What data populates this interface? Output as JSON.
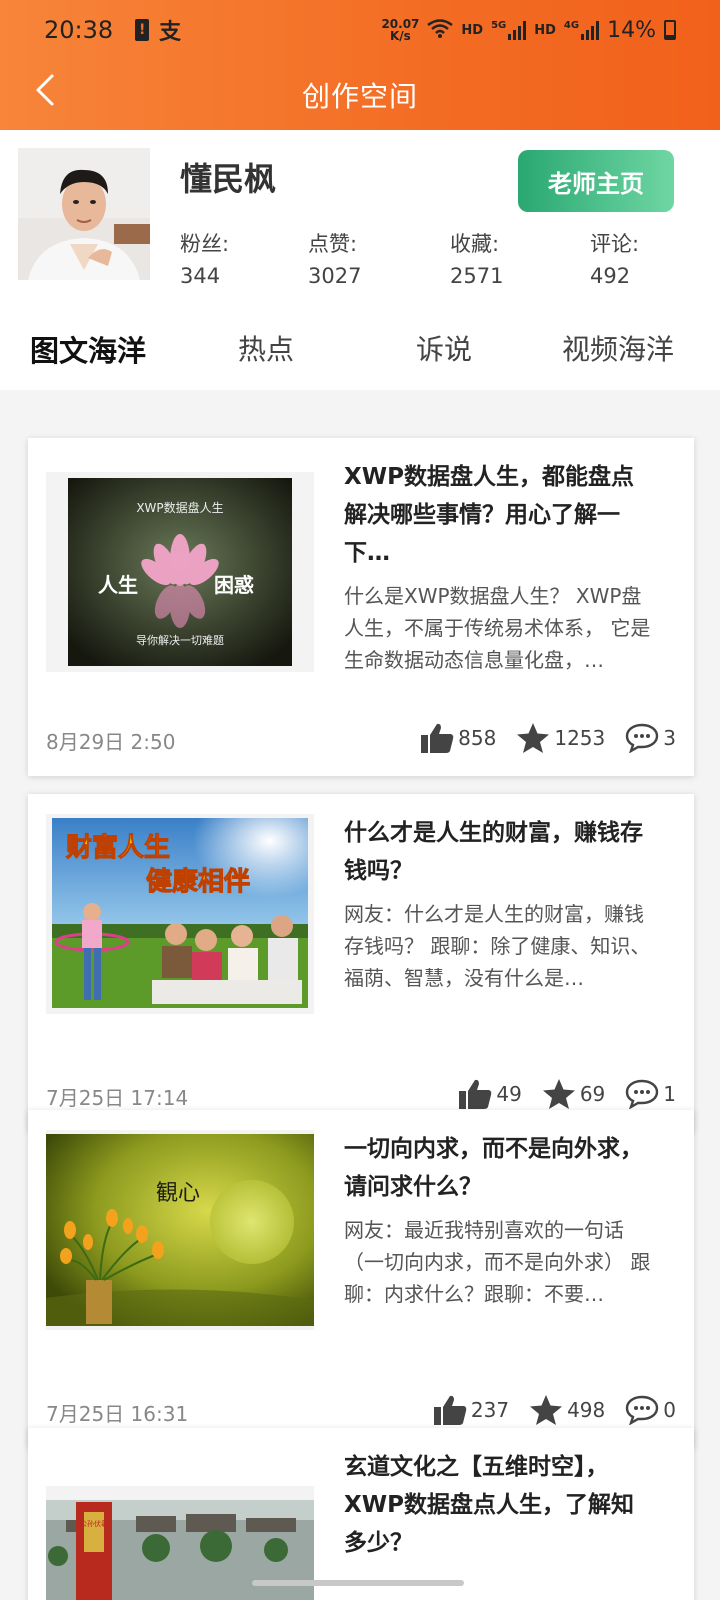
{
  "status_bar": {
    "time": "20:38",
    "pay_glyph": "支",
    "net_speed_value": "20.07",
    "net_speed_unit": "K/s",
    "hd1": "HD",
    "sig1_tag": "5G",
    "hd2": "HD",
    "sig2_tag": "4G",
    "battery_pct": "14%"
  },
  "nav": {
    "title": "创作空间"
  },
  "profile": {
    "name": "懂民枫",
    "teacher_button": "老师主页",
    "stats": [
      {
        "label": "粉丝:",
        "value": "344"
      },
      {
        "label": "点赞:",
        "value": "3027"
      },
      {
        "label": "收藏:",
        "value": "2571"
      },
      {
        "label": "评论:",
        "value": "492"
      }
    ]
  },
  "tabs": [
    {
      "label": "图文海洋",
      "active": true
    },
    {
      "label": "热点",
      "active": false
    },
    {
      "label": "诉说",
      "active": false
    },
    {
      "label": "视频海洋",
      "active": false
    }
  ],
  "posts": [
    {
      "title": "XWP数据盘人生，都能盘点解决哪些事情？用心了解一下…",
      "summary": "什么是XWP数据盘人生？ XWP盘人生，不属于传统易术体系， 它是生命数据动态信息量化盘，…",
      "date": "8月29日 2:50",
      "likes": "858",
      "favorites": "1253",
      "comments": "3",
      "thumb": {
        "caption_top": "XWP数据盘人生",
        "caption_left": "人生",
        "caption_right": "困惑",
        "caption_bottom": "导你解决一切难题"
      }
    },
    {
      "title": "什么才是人生的财富，赚钱存钱吗？",
      "summary": "网友：什么才是人生的财富，赚钱存钱吗？ 跟聊：除了健康、知识、福荫、智慧，没有什么是…",
      "date": "7月25日 17:14",
      "likes": "49",
      "favorites": "69",
      "comments": "1",
      "thumb": {
        "caption_line1": "财富人生",
        "caption_line2": "健康相伴"
      }
    },
    {
      "title": "一切向内求，而不是向外求，请问求什么？",
      "summary": "网友：最近我特别喜欢的一句话（一切向内求，而不是向外求） 跟聊：内求什么？跟聊：不要…",
      "date": "7月25日 16:31",
      "likes": "237",
      "favorites": "498",
      "comments": "0",
      "thumb": {
        "calligraphy": "観心"
      }
    },
    {
      "title": "玄道文化之【五维时空】，XWP数据盘点人生，了解知多少？",
      "thumb": {
        "sign_text": "公孙伏羲"
      }
    }
  ],
  "colors": {
    "header_orange": "#f36c24",
    "teacher_green": "#2aa872",
    "page_bg": "#f4f4f4"
  },
  "icons": [
    "back-chevron-icon",
    "thumb-up-icon",
    "star-icon",
    "comment-icon",
    "wifi-icon",
    "battery-icon"
  ]
}
